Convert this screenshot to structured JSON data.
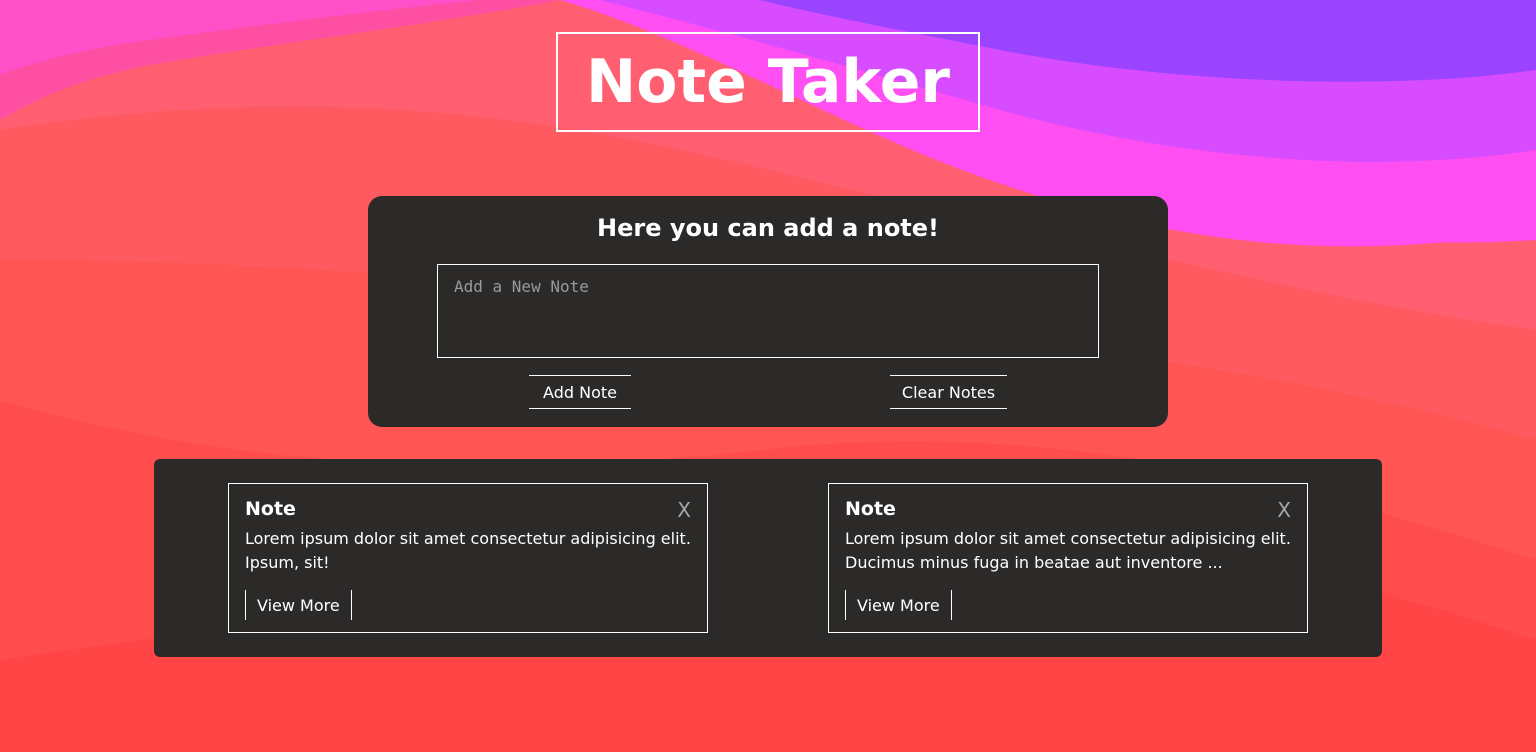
{
  "app": {
    "title": "Note Taker"
  },
  "colors": {
    "panel_background": "#2b2a29",
    "text": "#ffffff",
    "placeholder_text": "#9a9a9a",
    "close_icon": "#a6a6a6",
    "background_gradient": [
      "#9a44ff",
      "#ff4ef2",
      "#ff5e7e",
      "#ff4a4a",
      "#ff3d3d"
    ]
  },
  "add_panel": {
    "heading": "Here you can add a note!",
    "input_placeholder": "Add a New Note",
    "input_value": "",
    "add_button_label": "Add Note",
    "clear_button_label": "Clear Notes"
  },
  "notes": [
    {
      "title": "Note",
      "close_label": "X",
      "text_line_1": "Lorem ipsum dolor sit amet consectetur adipisicing elit.",
      "text_line_2": "Ipsum, sit!",
      "view_more_label": "View More"
    },
    {
      "title": "Note",
      "close_label": "X",
      "text_line_1": "Lorem ipsum dolor sit amet consectetur adipisicing elit.",
      "text_line_2": "Ducimus minus fuga in beatae aut inventore ...",
      "view_more_label": "View More"
    }
  ]
}
